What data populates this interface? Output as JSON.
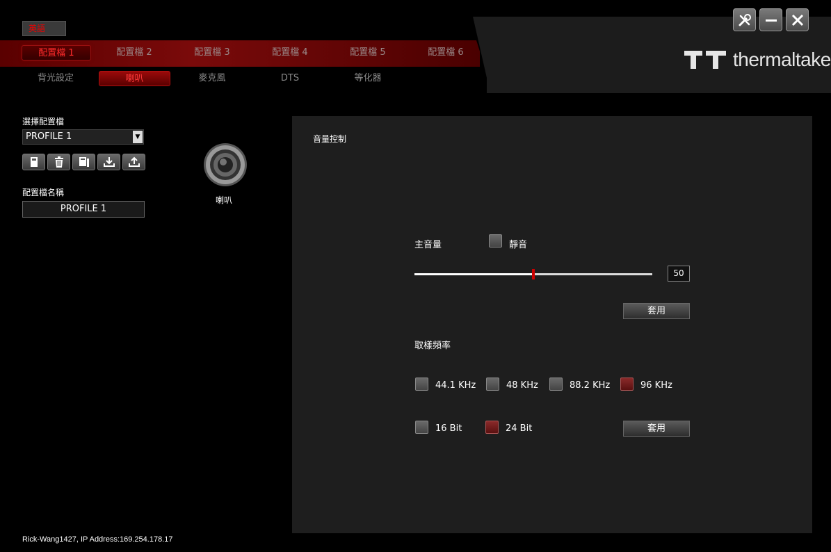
{
  "language_button": "英語",
  "profile_tabs": [
    {
      "label": "配置檔 1"
    },
    {
      "label": "配置檔 2"
    },
    {
      "label": "配置檔 3"
    },
    {
      "label": "配置檔 4"
    },
    {
      "label": "配置檔 5"
    },
    {
      "label": "配置檔 6"
    }
  ],
  "sub_tabs": [
    {
      "label": "背光設定"
    },
    {
      "label": "喇叭"
    },
    {
      "label": "麥克風"
    },
    {
      "label": "DTS"
    },
    {
      "label": "等化器"
    }
  ],
  "brand": {
    "name": "thermaltake"
  },
  "left": {
    "select_profile_label": "選擇配置檔",
    "selected_profile": "PROFILE 1",
    "profile_name_label": "配置檔名稱",
    "profile_name_value": "PROFILE 1"
  },
  "device": {
    "label": "喇叭"
  },
  "volume": {
    "title": "音量控制",
    "master_label": "主音量",
    "mute_label": "靜音",
    "mute_checked": false,
    "value": "50",
    "value_fraction": 0.5,
    "apply_label": "套用"
  },
  "sampling": {
    "title": "取樣頻率",
    "rates": [
      {
        "label": "44.1 KHz",
        "checked": false
      },
      {
        "label": "48 KHz",
        "checked": false
      },
      {
        "label": "88.2 KHz",
        "checked": false
      },
      {
        "label": "96 KHz",
        "checked": true
      }
    ],
    "bits": [
      {
        "label": "16 Bit",
        "checked": false
      },
      {
        "label": "24 Bit",
        "checked": true
      }
    ],
    "apply_label": "套用"
  },
  "status_bar": "Rick-Wang1427, IP Address:169.254.178.17",
  "colors": {
    "accent": "#c00000",
    "panel": "#1e1e1e"
  }
}
